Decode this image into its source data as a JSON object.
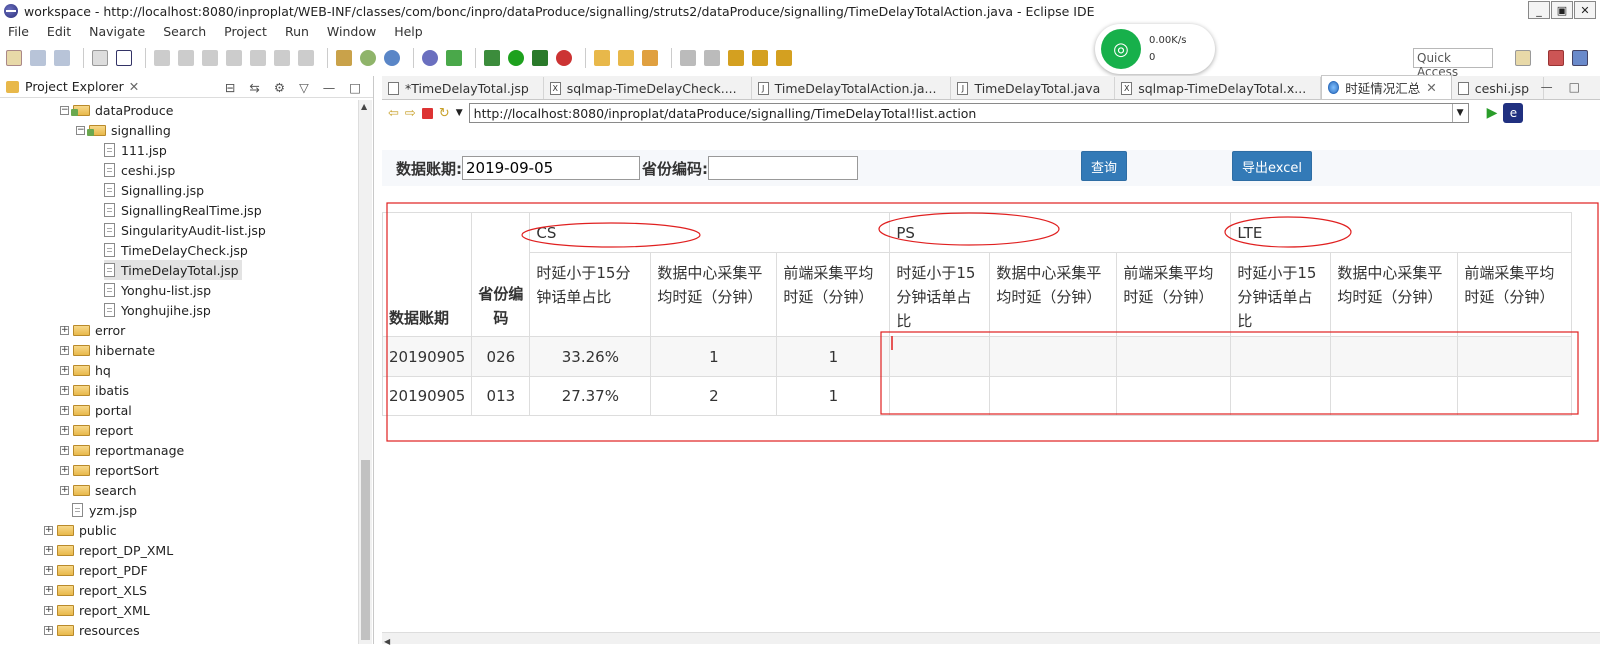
{
  "window": {
    "title": "workspace - http://localhost:8080/inproplat/WEB-INF/classes/com/bonc/inpro/dataProduce/signalling/struts2/dataProduce/signalling/TimeDelayTotalAction.java - Eclipse IDE",
    "controls": [
      "_",
      "▣",
      "✕"
    ]
  },
  "menu": [
    "File",
    "Edit",
    "Navigate",
    "Search",
    "Project",
    "Run",
    "Window",
    "Help"
  ],
  "quick_access": {
    "placeholder": "Quick Access"
  },
  "network_widget": {
    "speed": "0.00K/s",
    "count": "0"
  },
  "project_explorer": {
    "title": "Project Explorer",
    "close": "✕",
    "items": [
      {
        "label": "dataProduce",
        "type": "folder",
        "expanded": true
      },
      {
        "label": "signalling",
        "type": "folder",
        "expanded": true
      },
      {
        "label": "111.jsp",
        "type": "file"
      },
      {
        "label": "ceshi.jsp",
        "type": "file"
      },
      {
        "label": "Signalling.jsp",
        "type": "file"
      },
      {
        "label": "SignallingRealTime.jsp",
        "type": "file"
      },
      {
        "label": "SingularityAudit-list.jsp",
        "type": "file"
      },
      {
        "label": "TimeDelayCheck.jsp",
        "type": "file"
      },
      {
        "label": "TimeDelayTotal.jsp",
        "type": "file",
        "selected": true
      },
      {
        "label": "Yonghu-list.jsp",
        "type": "file"
      },
      {
        "label": "Yonghujihe.jsp",
        "type": "file"
      },
      {
        "label": "error",
        "type": "folder"
      },
      {
        "label": "hibernate",
        "type": "folder"
      },
      {
        "label": "hq",
        "type": "folder"
      },
      {
        "label": "ibatis",
        "type": "folder"
      },
      {
        "label": "portal",
        "type": "folder"
      },
      {
        "label": "report",
        "type": "folder"
      },
      {
        "label": "reportmanage",
        "type": "folder"
      },
      {
        "label": "reportSort",
        "type": "folder"
      },
      {
        "label": "search",
        "type": "folder"
      },
      {
        "label": "yzm.jsp",
        "type": "file"
      },
      {
        "label": "public",
        "type": "folder"
      },
      {
        "label": "report_DP_XML",
        "type": "folder"
      },
      {
        "label": "report_PDF",
        "type": "folder"
      },
      {
        "label": "report_XLS",
        "type": "folder"
      },
      {
        "label": "report_XML",
        "type": "folder"
      },
      {
        "label": "resources",
        "type": "folder"
      }
    ]
  },
  "editor_tabs": [
    {
      "label": "*TimeDelayTotal.jsp",
      "icon": "jsp"
    },
    {
      "label": "sqlmap-TimeDelayCheck....",
      "icon": "xml"
    },
    {
      "label": "TimeDelayTotalAction.ja...",
      "icon": "java"
    },
    {
      "label": "TimeDelayTotal.java",
      "icon": "java"
    },
    {
      "label": "sqlmap-TimeDelayTotal.x...",
      "icon": "xml"
    },
    {
      "label": "时延情况汇总",
      "icon": "globe",
      "active": true
    },
    {
      "label": "ceshi.jsp",
      "icon": "jsp"
    }
  ],
  "browser": {
    "url": "http://localhost:8080/inproplat/dataProduce/signalling/TimeDelayTotal!list.action"
  },
  "form": {
    "period_label": "数据账期:",
    "period_value": "2019-09-05",
    "province_label": "省份编码:",
    "province_value": "",
    "query_button": "查询",
    "export_button": "导出excel"
  },
  "table": {
    "col_period": "数据账期",
    "col_province": "省份编码",
    "groups": [
      "CS",
      "PS",
      "LTE"
    ],
    "subheaders": [
      "时延小于15分钟话单占比",
      "数据中心采集平均时延（分钟）",
      "前端采集平均时延（分钟）",
      "时延小于15分钟话单占比",
      "数据中心采集平均时延（分钟）",
      "前端采集平均时延（分钟）",
      "时延小于15分钟话单占比",
      "数据中心采集平均时延（分钟）",
      "前端采集平均时延（分钟）"
    ],
    "rows": [
      [
        "20190905",
        "026",
        "33.26%",
        "1",
        "1",
        "",
        "",
        "",
        "",
        "",
        ""
      ],
      [
        "20190905",
        "013",
        "27.37%",
        "2",
        "1",
        "",
        "",
        "",
        "",
        "",
        ""
      ]
    ]
  },
  "colors": {
    "accent_button": "#337ab7",
    "annotation": "#e02020",
    "wifi": "#17b04b"
  }
}
